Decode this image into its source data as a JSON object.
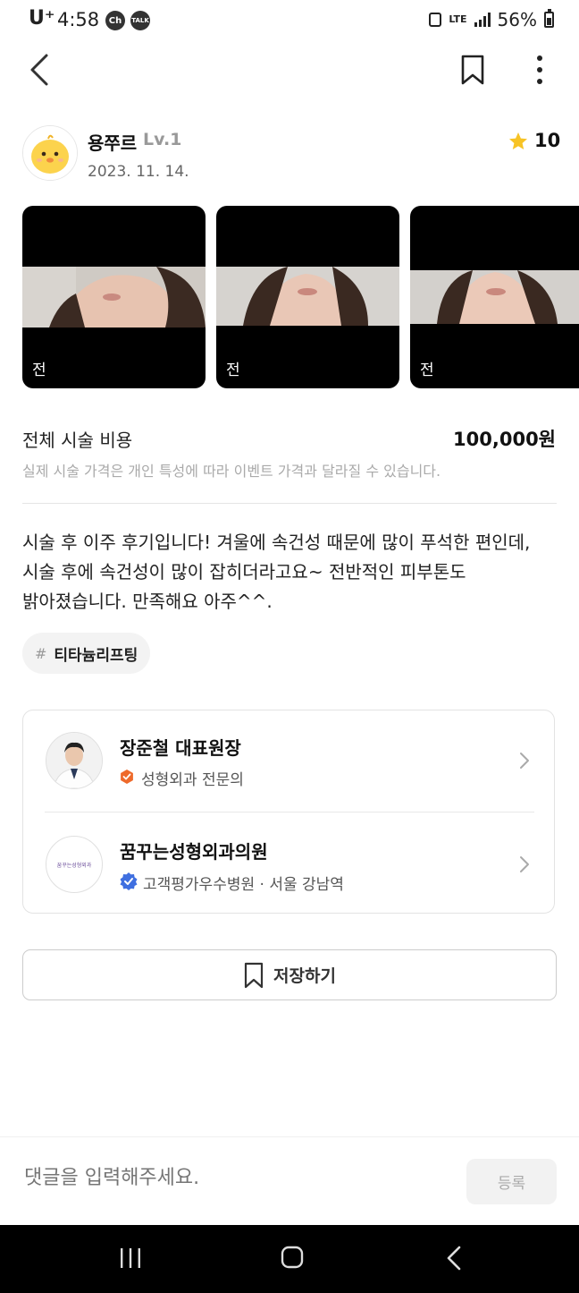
{
  "status_bar": {
    "carrier": "U⁺",
    "time": "4:58",
    "ch_label": "Ch",
    "talk_label": "TALK",
    "network": "LTE",
    "battery": "56%"
  },
  "author": {
    "username": "용쭈르",
    "level": "Lv.1",
    "date": "2023. 11. 14.",
    "rating": "10"
  },
  "photos": [
    {
      "label": "전"
    },
    {
      "label": "전"
    },
    {
      "label": "전"
    }
  ],
  "cost": {
    "label": "전체 시술 비용",
    "value": "100,000원",
    "note": "실제 시술 가격은 개인 특성에 따라 이벤트 가격과 달라질 수 있습니다."
  },
  "review": {
    "lines": [
      "시술 후 이주 후기입니다! 겨울에 속건성 때문에 많이 푸석한 편인데,",
      "시술 후에 속건성이 많이 잡히더라고요~ 전반적인 피부톤도",
      "밝아졌습니다. 만족해요 아주^^."
    ]
  },
  "tag": {
    "hash": "#",
    "label": "티타늄리프팅"
  },
  "doctor": {
    "name": "장준철 대표원장",
    "role": "성형외과 전문의"
  },
  "hospital": {
    "logo_text": "꿈꾸는성형외과",
    "name": "꿈꾸는성형외과의원",
    "meta": "고객평가우수병원 · 서울 강남역"
  },
  "save_label": "저장하기",
  "comment": {
    "placeholder": "댓글을 입력해주세요.",
    "submit_label": "등록"
  },
  "colors": {
    "star": "#f7c325",
    "badge_orange": "#ee6a2b",
    "badge_blue": "#3f6fe0"
  }
}
